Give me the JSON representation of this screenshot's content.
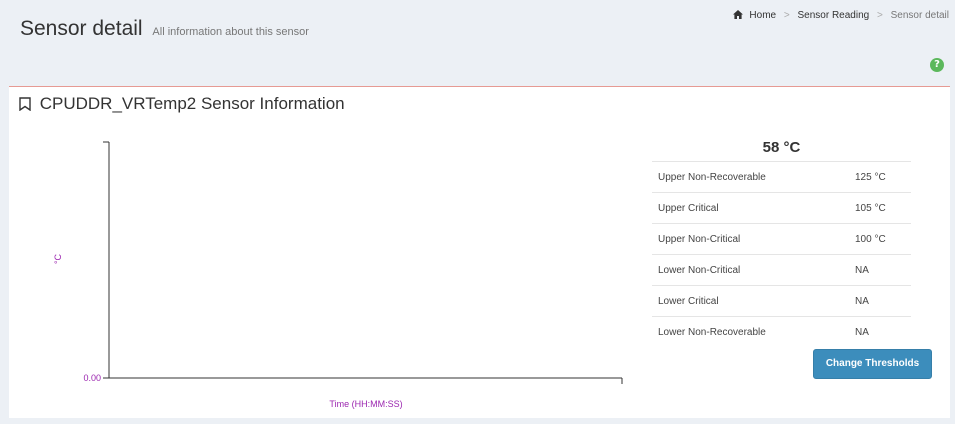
{
  "header": {
    "title": "Sensor detail",
    "subtitle": "All information about this sensor"
  },
  "breadcrumb": {
    "items": [
      "Home",
      "Sensor Reading",
      "Sensor detail"
    ],
    "separator": ">"
  },
  "help_icon": "?",
  "box": {
    "title": "CPUDDR_VRTemp2 Sensor Information",
    "title_icon": "bookmark-icon"
  },
  "chart_data": {
    "type": "line",
    "ylabel": "°C",
    "xlabel": "Time (HH:MM:SS)",
    "yticks": [
      "0.00"
    ],
    "series": []
  },
  "reading": "58 °C",
  "thresholds": [
    {
      "label": "Upper Non-Recoverable",
      "value": "125 °C"
    },
    {
      "label": "Upper Critical",
      "value": "105 °C"
    },
    {
      "label": "Upper Non-Critical",
      "value": "100 °C"
    },
    {
      "label": "Lower Non-Critical",
      "value": "NA"
    },
    {
      "label": "Lower Critical",
      "value": "NA"
    },
    {
      "label": "Lower Non-Recoverable",
      "value": "NA"
    }
  ],
  "change_thresholds_label": "Change Thresholds",
  "colors": {
    "accent_border": "#e69a93",
    "axis_label": "#9c27b0",
    "button": "#3c8dbc",
    "help": "#5cb85c"
  }
}
